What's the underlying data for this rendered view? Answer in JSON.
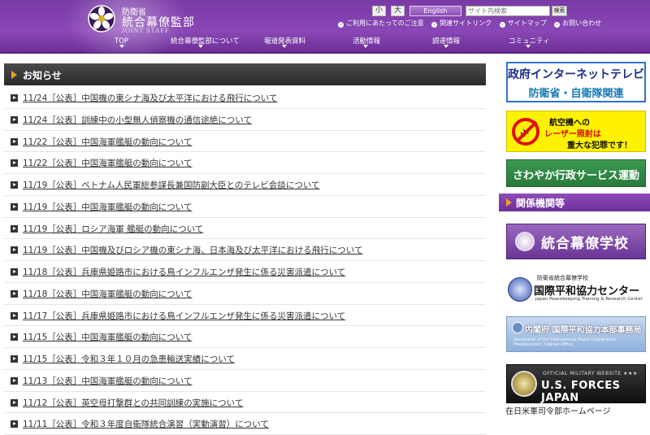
{
  "header": {
    "ministry": "防衛省",
    "org_name": "統合幕僚監部",
    "org_en": "JOINT STAFF",
    "font_small": "小",
    "font_large": "大",
    "english": "English",
    "search_placeholder": "サイト内検索",
    "search_button": "検索",
    "util_links": [
      "ご利用にあたってのご注意",
      "関連サイトリンク",
      "サイトマップ",
      "お問い合わせ"
    ],
    "nav": [
      "TOP",
      "統合幕僚監部について",
      "報道発表資料",
      "活動情報",
      "調達情報",
      "コミュニティ"
    ]
  },
  "news": {
    "title": "お知らせ",
    "items": [
      "11/24［公表］中国機の東シナ海及び太平洋における飛行について",
      "11/24［公表］訓練中の小型無人偵察機の通信途絶について",
      "11/22［公表］中国海軍艦艇の動向について",
      "11/22［公表］中国海軍艦艇の動向について",
      "11/19［公表］ベトナム人民軍総参謀長兼国防副大臣とのテレビ会談について",
      "11/19［公表］中国海軍艦艇の動向について",
      "11/19［公表］ロシア海軍 艦艇の動向について",
      "11/19［公表］中国機及びロシア機の東シナ海、日本海及び太平洋における飛行について",
      "11/18［公表］兵庫県姫路市における鳥インフルエンザ発生に係る災害派遣について",
      "11/18［公表］中国海軍艦艇の動向について",
      "11/17［公表］兵庫県姫路市における鳥インフルエンザ発生に係る災害派遣について",
      "11/15［公表］中国海軍艦艇の動向について",
      "11/15［公表］令和３年１０月の急患輸送実績について",
      "11/13［公表］中国海軍艦艇の動向について",
      "11/12［公表］英空母打撃群との共同訓練の実施について",
      "11/11［公表］令和３年度自衛隊統合演習（実動演習）について"
    ]
  },
  "sidebar": {
    "tv_line1": "政府インターネットテレビ",
    "tv_line2": "防衛省・自衛隊関連",
    "laser_line1": "航空機への",
    "laser_line2": "レーザー照射は",
    "laser_line3": "重大な犯罪です！",
    "sawayaka": "さわやか行政サービス運動",
    "related_title": "関係機関等",
    "school": "統合幕僚学校",
    "ipc_line1": "防衛省統合幕僚学校",
    "ipc_line2": "国際平和協力センター",
    "ipc_line3": "Japan Peacekeeping Training & Research Center",
    "pko_line1": "内閣府 国際平和協力本部事務局",
    "pko_line2": "Secretariat of the International Peace Cooperation Headquarters, Cabinet Office",
    "usfj_line1": "OFFICIAL MILITARY WEBSITE ★★★",
    "usfj_line2": "U.S. FORCES JAPAN",
    "usfj_caption": "在日米軍司令部ホームページ"
  },
  "colors": {
    "header_purple": "#7a3aa6",
    "news_header": "#333333",
    "accent_orange": "#f0a020"
  }
}
